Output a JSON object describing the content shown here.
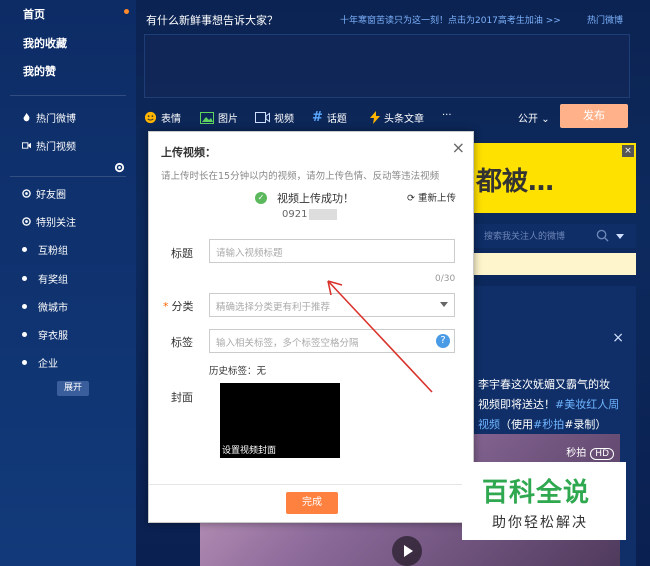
{
  "sidebar": {
    "top_items": [
      "首页",
      "我的收藏",
      "我的赞"
    ],
    "hot_items": [
      "热门微博",
      "热门视频"
    ],
    "group_items": [
      "好友圈",
      "特别关注"
    ],
    "sub_items": [
      "互粉组",
      "有奖组",
      "微城市",
      "穿衣服",
      "企业"
    ],
    "expand_label": "展开"
  },
  "publisher": {
    "title": "有什么新鲜事想告诉大家？",
    "hint": "十年寒窗苦读只为这一刻！点击为2017高考生加油 >>",
    "hot_label": "热门微博",
    "tools": [
      "表情",
      "图片",
      "视频",
      "话题",
      "头条文章",
      "···"
    ],
    "public_label": "公开",
    "publish_label": "发布"
  },
  "banner": {
    "text": "都被…",
    "close": "×"
  },
  "search": {
    "placeholder": "搜索我关注人的微博"
  },
  "feed": {
    "close": "×",
    "lines": [
      "李宇春这次妩媚又霸气的妆",
      "视频即将送达！",
      "#美妆红人周",
      "视频",
      "（使用",
      "#秒拍",
      "#录制）"
    ],
    "brand": "秒拍",
    "hd": "HD"
  },
  "dialog": {
    "title": "上传视频：",
    "close": "×",
    "note": "请上传时长在15分钟以内的视频，请勿上传色情、反动等违法视频",
    "success_text": "视频上传成功！",
    "reupload": "重新上传",
    "file_name": "0921",
    "title_label": "标题",
    "title_placeholder": "请输入视频标题",
    "title_count": "0/30",
    "category_label": "分类",
    "category_placeholder": "精确选择分类更有利于推荐",
    "tags_label": "标签",
    "tags_placeholder": "输入相关标签，多个标签空格分隔",
    "help": "?",
    "history_label": "历史标签：无",
    "cover_label": "封面",
    "cover_overlay": "设置视频封面",
    "done_label": "完成"
  },
  "watermark": {
    "title": "百科全说",
    "subtitle": "助你轻松解决"
  }
}
